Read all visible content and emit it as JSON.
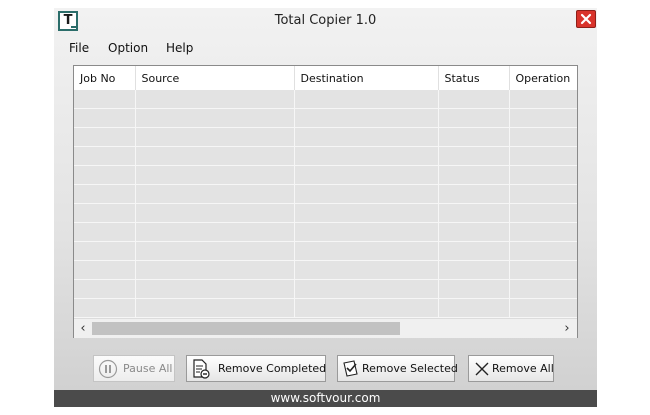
{
  "window": {
    "title": "Total Copier 1.0",
    "icon_letter": "T",
    "close_icon": "close-x-icon"
  },
  "menu": [
    "File",
    "Option",
    "Help"
  ],
  "table": {
    "columns": [
      "Job No",
      "Source",
      "Destination",
      "Status",
      "Operation"
    ],
    "rows": []
  },
  "buttons": {
    "pause_all": "Pause All",
    "remove_completed": "Remove Completed",
    "remove_selected": "Remove Selected",
    "remove_all": "Remove All"
  },
  "footer": {
    "text": "www.softvour.com"
  },
  "colors": {
    "close": "#d9332b",
    "footer_bg": "#4b4b4b",
    "row_bg": "#e3e3e3"
  }
}
